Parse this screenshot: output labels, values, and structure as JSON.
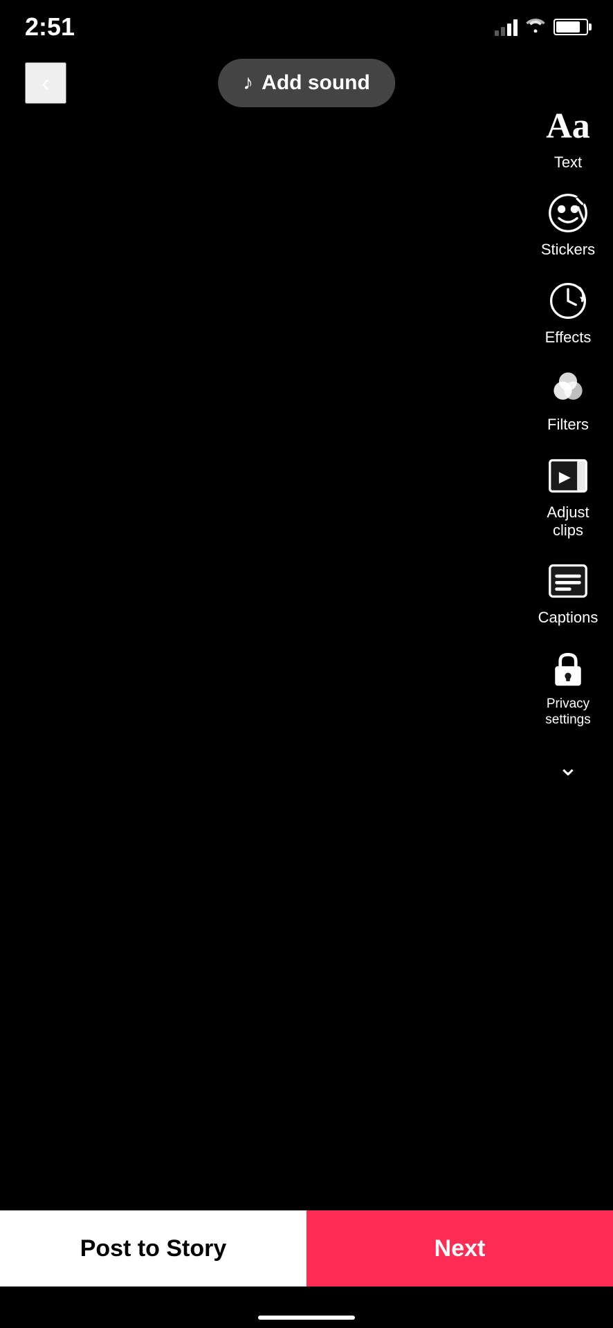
{
  "status": {
    "time": "2:51",
    "signal_bars": [
      1,
      2,
      3,
      4
    ],
    "signal_active": 2
  },
  "header": {
    "add_sound_label": "Add sound"
  },
  "toolbar": {
    "items": [
      {
        "id": "text",
        "label": "Text",
        "icon_type": "text-aa"
      },
      {
        "id": "stickers",
        "label": "Stickers",
        "icon_type": "stickers"
      },
      {
        "id": "effects",
        "label": "Effects",
        "icon_type": "effects"
      },
      {
        "id": "filters",
        "label": "Filters",
        "icon_type": "filters"
      },
      {
        "id": "adjust-clips",
        "label": "Adjust clips",
        "icon_type": "adjust-clips"
      },
      {
        "id": "captions",
        "label": "Captions",
        "icon_type": "captions"
      },
      {
        "id": "privacy",
        "label": "Privacy settings",
        "icon_type": "privacy"
      }
    ]
  },
  "bottom": {
    "post_story_label": "Post to Story",
    "next_label": "Next"
  }
}
